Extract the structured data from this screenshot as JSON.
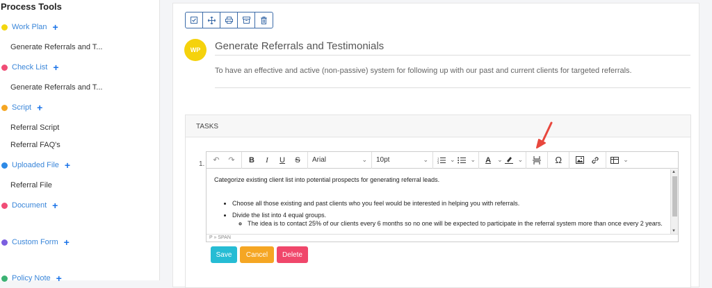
{
  "sidebar": {
    "title": "Process Tools",
    "add_symbol": "+",
    "sections": [
      {
        "label": "Work Plan",
        "color": "#f3d60f",
        "items": [
          "Generate Referrals and T..."
        ]
      },
      {
        "label": "Check List",
        "color": "#f04d76",
        "items": [
          "Generate Referrals and T..."
        ]
      },
      {
        "label": "Script",
        "color": "#f5a623",
        "items": [
          "Referral Script",
          "Referral FAQ's"
        ]
      },
      {
        "label": "Uploaded File",
        "color": "#2d8ae6",
        "items": [
          "Referral File"
        ]
      },
      {
        "label": "Document",
        "color": "#f04d76",
        "items": []
      },
      {
        "label": "Custom Form",
        "color": "#7b5fe0",
        "items": []
      },
      {
        "label": "Policy Note",
        "color": "#3bb273",
        "items": []
      }
    ]
  },
  "process": {
    "avatar": "WP",
    "title": "Generate Referrals and Testimonials",
    "description": "To have an effective and active (non-passive) system for following up with our past and current clients for targeted referrals."
  },
  "tasks": {
    "header": "TASKS",
    "item_number": "1.",
    "editor": {
      "font": "Arial",
      "size": "10pt",
      "content": {
        "intro": "Categorize existing client list into potential prospects for generating referral leads.",
        "bullet1": "Choose all those existing and past clients who you feel would be interested in helping you with referrals.",
        "bullet2": "Divide the list into 4 equal groups.",
        "sub_bullet": "The idea is to contact 25% of our clients every 6 months so no one will be expected to participate in the referral system more than once every 2 years."
      },
      "status_path": "P » SPAN"
    },
    "buttons": {
      "save": "Save",
      "cancel": "Cancel",
      "delete": "Delete"
    }
  },
  "colors": {
    "accent": "#2d8ae6",
    "arrow": "#e8473d"
  }
}
